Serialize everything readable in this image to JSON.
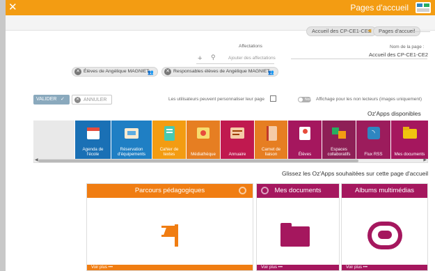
{
  "header": {
    "title": "Pages d'accueil",
    "close_icon": "close-icon",
    "app_icon": "pages-app-icon",
    "color": "#f39c12"
  },
  "breadcrumb": {
    "items": [
      "Pages d'accueil",
      "Accueil des CP-CE1-CE2"
    ]
  },
  "form": {
    "name_label": "Nom de la page :",
    "name_value": "Accueil des CP-CE1-CE2",
    "assign_label": "Affectations",
    "assign_placeholder": "Ajouter des affectations",
    "tags": [
      "Responsables élèves de Angélique MAGNIET",
      "Élèves de Angélique MAGNIET"
    ]
  },
  "options": {
    "readers_label": "Affichage pour les non lecteurs (images uniquement)",
    "toggle_state": "Non",
    "users_customize_label": "Les utilisateurs peuvent personnaliser leur page"
  },
  "buttons": {
    "cancel": "ANNULER",
    "validate": "VALIDER"
  },
  "available": {
    "title": "Oz'Apps disponibles",
    "apps": [
      {
        "label": "Mes documents",
        "color": "#a5175e",
        "icon": "folder-icon"
      },
      {
        "label": "Flux RSS",
        "color": "#9c1c5c",
        "icon": "rss-icon"
      },
      {
        "label": "Espaces collaboratifs",
        "color": "#8e1f56",
        "icon": "collaborative-spaces-icon"
      },
      {
        "label": "Élèves",
        "color": "#a5175e",
        "icon": "students-icon"
      },
      {
        "label": "Carnet de liaison",
        "color": "#e67e22",
        "icon": "notebook-icon"
      },
      {
        "label": "Annuaire",
        "color": "#c0194f",
        "icon": "directory-icon"
      },
      {
        "label": "Médiathèque",
        "color": "#e67e22",
        "icon": "media-library-icon"
      },
      {
        "label": "Cahier de textes",
        "color": "#f39c12",
        "icon": "textbook-icon"
      },
      {
        "label": "Réservation d'équipements",
        "color": "#1f7fc4",
        "icon": "booking-icon"
      },
      {
        "label": "Agenda de l'école",
        "color": "#1a70b5",
        "icon": "calendar-icon"
      }
    ]
  },
  "drop": {
    "title": "Glissez les Oz'Apps souhaitées sur cette page d'accueil"
  },
  "cards": [
    {
      "title": "Albums multimédias",
      "color": "#a5175e",
      "more": "Voir plus •••",
      "icon": "multimedia-albums-icon"
    },
    {
      "title": "Mes documents",
      "color": "#a5175e",
      "more": "Voir plus •••",
      "icon": "folder-icon"
    },
    {
      "title": "Parcours pédagogiques",
      "color": "#f07d12",
      "more": "Voir plus •••",
      "icon": "flag-icon"
    }
  ]
}
